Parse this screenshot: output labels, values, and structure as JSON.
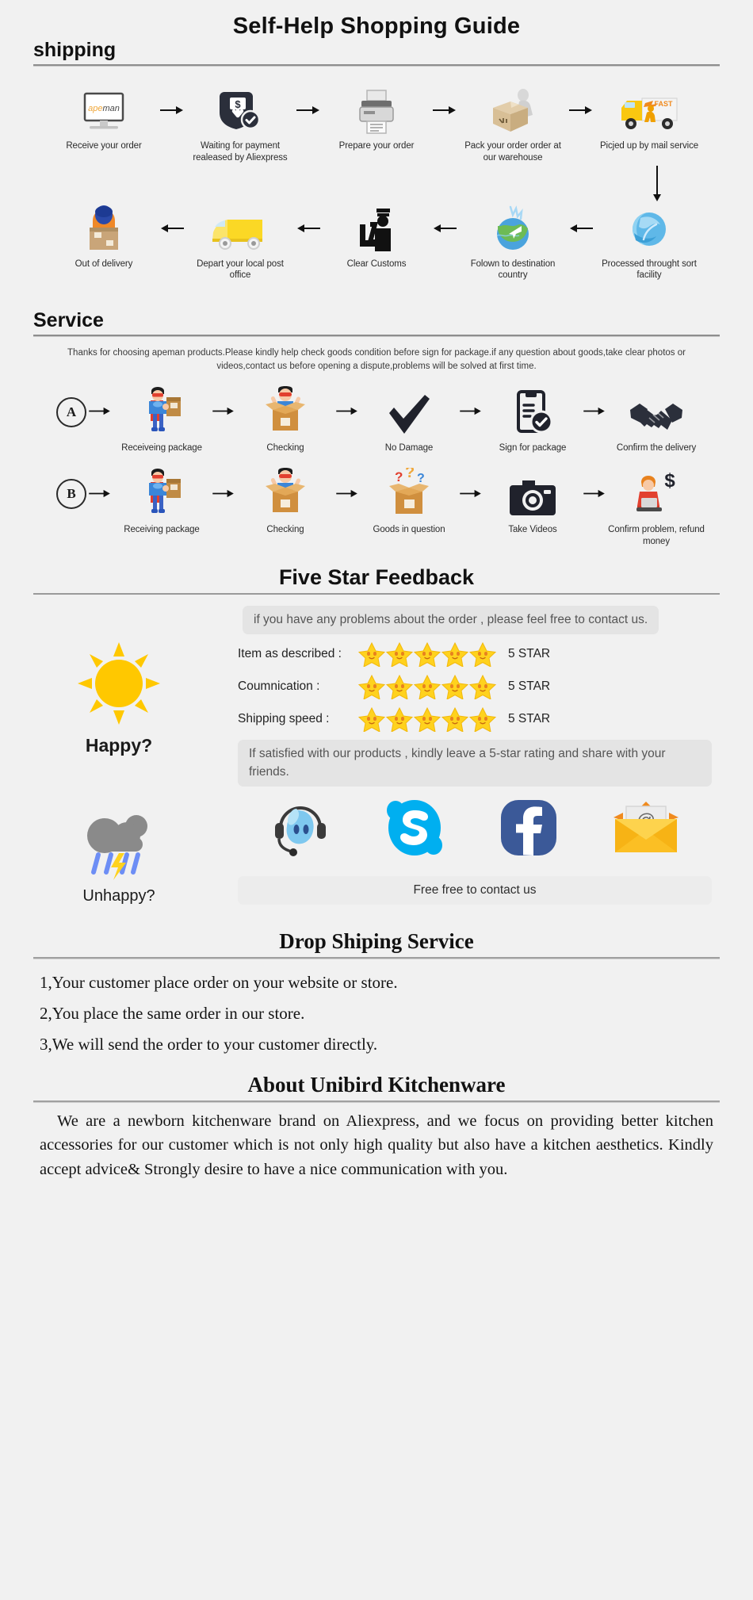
{
  "title": "Self-Help Shopping Guide",
  "shipping": {
    "heading": "shipping",
    "row1": [
      {
        "label": "Receive your order",
        "icon": "monitor-apeman-icon",
        "brand": "apeman"
      },
      {
        "label": "Waiting for payment realeased by Aliexpress",
        "icon": "payment-shield-dollar-icon"
      },
      {
        "label": "Prepare your order",
        "icon": "printer-icon"
      },
      {
        "label": "Pack your order order at our warehouse",
        "icon": "packing-box-worker-icon"
      },
      {
        "label": "Picjed up by mail service",
        "icon": "fast-delivery-truck-icon",
        "truck_text": "FAST"
      }
    ],
    "row2": [
      {
        "label": "Out of delivery",
        "icon": "courier-carrying-box-icon"
      },
      {
        "label": "Depart your local post office",
        "icon": "yellow-van-icon"
      },
      {
        "label": "Clear Customs",
        "icon": "customs-officer-icon"
      },
      {
        "label": "Folown to destination country",
        "icon": "globe-airplane-icon"
      },
      {
        "label": "Processed throught sort facility",
        "icon": "blue-globe-sort-icon"
      }
    ]
  },
  "service": {
    "heading": "Service",
    "note": "Thanks for choosing apeman products.Please kindly help check goods condition before sign for package.if any question about goods,take clear photos or videos,contact us before opening a dispute,problems will be solved at first time.",
    "rowA": {
      "badge": "A",
      "steps": [
        {
          "label": "Receiveing package",
          "icon": "hero-holding-package-icon"
        },
        {
          "label": "Checking",
          "icon": "hero-opening-box-icon"
        },
        {
          "label": "No Damage",
          "icon": "checkmark-icon"
        },
        {
          "label": "Sign for package",
          "icon": "signed-document-icon"
        },
        {
          "label": "Confirm the delivery",
          "icon": "handshake-icon"
        }
      ]
    },
    "rowB": {
      "badge": "B",
      "steps": [
        {
          "label": "Receiving package",
          "icon": "hero-holding-package-icon"
        },
        {
          "label": "Checking",
          "icon": "hero-opening-box-icon"
        },
        {
          "label": "Goods in question",
          "icon": "question-box-icon"
        },
        {
          "label": "Take Videos",
          "icon": "camera-icon"
        },
        {
          "label": "Confirm problem, refund money",
          "icon": "refund-person-dollar-icon"
        }
      ]
    }
  },
  "feedback": {
    "heading": "Five Star Feedback",
    "bubble_top": "if you have any problems about the order , please feel free to contact us.",
    "happy_label": "Happy?",
    "happy_icon": "sun-icon",
    "ratings": [
      {
        "label": "Item as described :",
        "stars": 5,
        "value": "5 STAR"
      },
      {
        "label": "Coumnication :",
        "stars": 5,
        "value": "5 STAR"
      },
      {
        "label": "Shipping speed :",
        "stars": 5,
        "value": "5 STAR"
      }
    ],
    "bubble_bottom": "If satisfied with our products , kindly leave a 5-star rating and share with your friends.",
    "unhappy_label": "Unhappy?",
    "unhappy_icon": "rain-cloud-icon",
    "contact_icons": [
      {
        "name": "support-headset-chat-icon"
      },
      {
        "name": "skype-icon"
      },
      {
        "name": "facebook-icon"
      },
      {
        "name": "email-envelope-icon"
      }
    ],
    "contact_button": "Free free to contact us"
  },
  "dropshipping": {
    "heading": "Drop Shiping Service",
    "items": [
      "1,Your customer place order on your website or store.",
      "2,You place the same order in our store.",
      "3,We will send the order to your customer directly."
    ]
  },
  "about": {
    "heading": "About Unibird Kitchenware",
    "body": "We are a newborn kitchenware brand on Aliexpress, and we focus on providing better kitchen accessories for our customer which is not only high quality but also have a kitchen aesthetics. Kindly accept advice& Strongly desire to have a nice communication with you."
  },
  "colors": {
    "background": "#f1f1f1",
    "dark": "#2b2f3b",
    "yellow": "#f5c400",
    "orange": "#e8821e",
    "skype_blue": "#00aff0",
    "facebook_blue": "#3b5998",
    "star_yellow": "#ffd21e"
  }
}
